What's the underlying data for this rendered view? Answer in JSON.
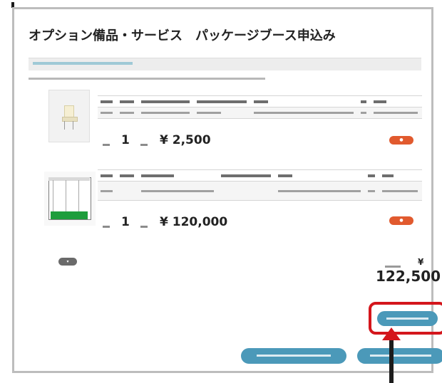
{
  "header": {
    "title": "オプション備品・サービス　パッケージブース申込み"
  },
  "items": [
    {
      "quantity": "1",
      "price": "¥ 2,500"
    },
    {
      "quantity": "1",
      "price": "¥ 120,000"
    }
  ],
  "total": {
    "yen_sign": "¥",
    "value": "122,500"
  },
  "icons": {
    "chair": "chair-photo",
    "booth": "package-booth-illustration",
    "arrow": "arrow-up-icon"
  },
  "colors": {
    "primary_button": "#4b99b9",
    "detail_button": "#e15a2e",
    "highlight": "#d4161c",
    "booth_floor": "#1e9d3c"
  }
}
